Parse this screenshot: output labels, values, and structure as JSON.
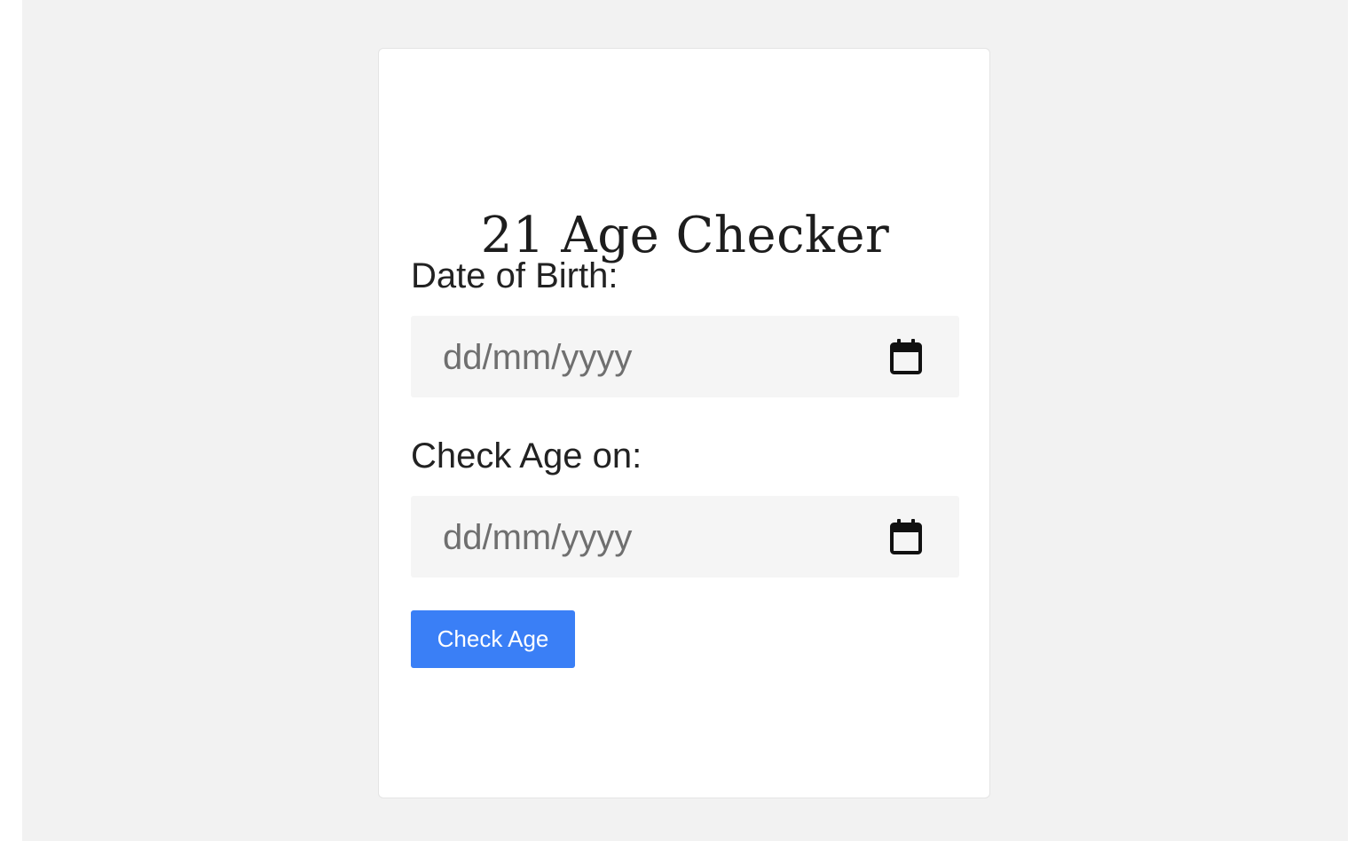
{
  "app": {
    "title": "21 Age Checker"
  },
  "form": {
    "dob_label": "Date of Birth:",
    "dob_placeholder": "dd/mm/yyyy",
    "dob_value": "",
    "check_on_label": "Check Age on:",
    "check_on_placeholder": "dd/mm/yyyy",
    "check_on_value": "",
    "calendar_icon": "calendar-icon",
    "submit_label": "Check Age"
  },
  "colors": {
    "page_background": "#f2f2f2",
    "card_background": "#ffffff",
    "input_background": "#f5f5f5",
    "button_background": "#3a7ff6",
    "button_text": "#ffffff"
  }
}
